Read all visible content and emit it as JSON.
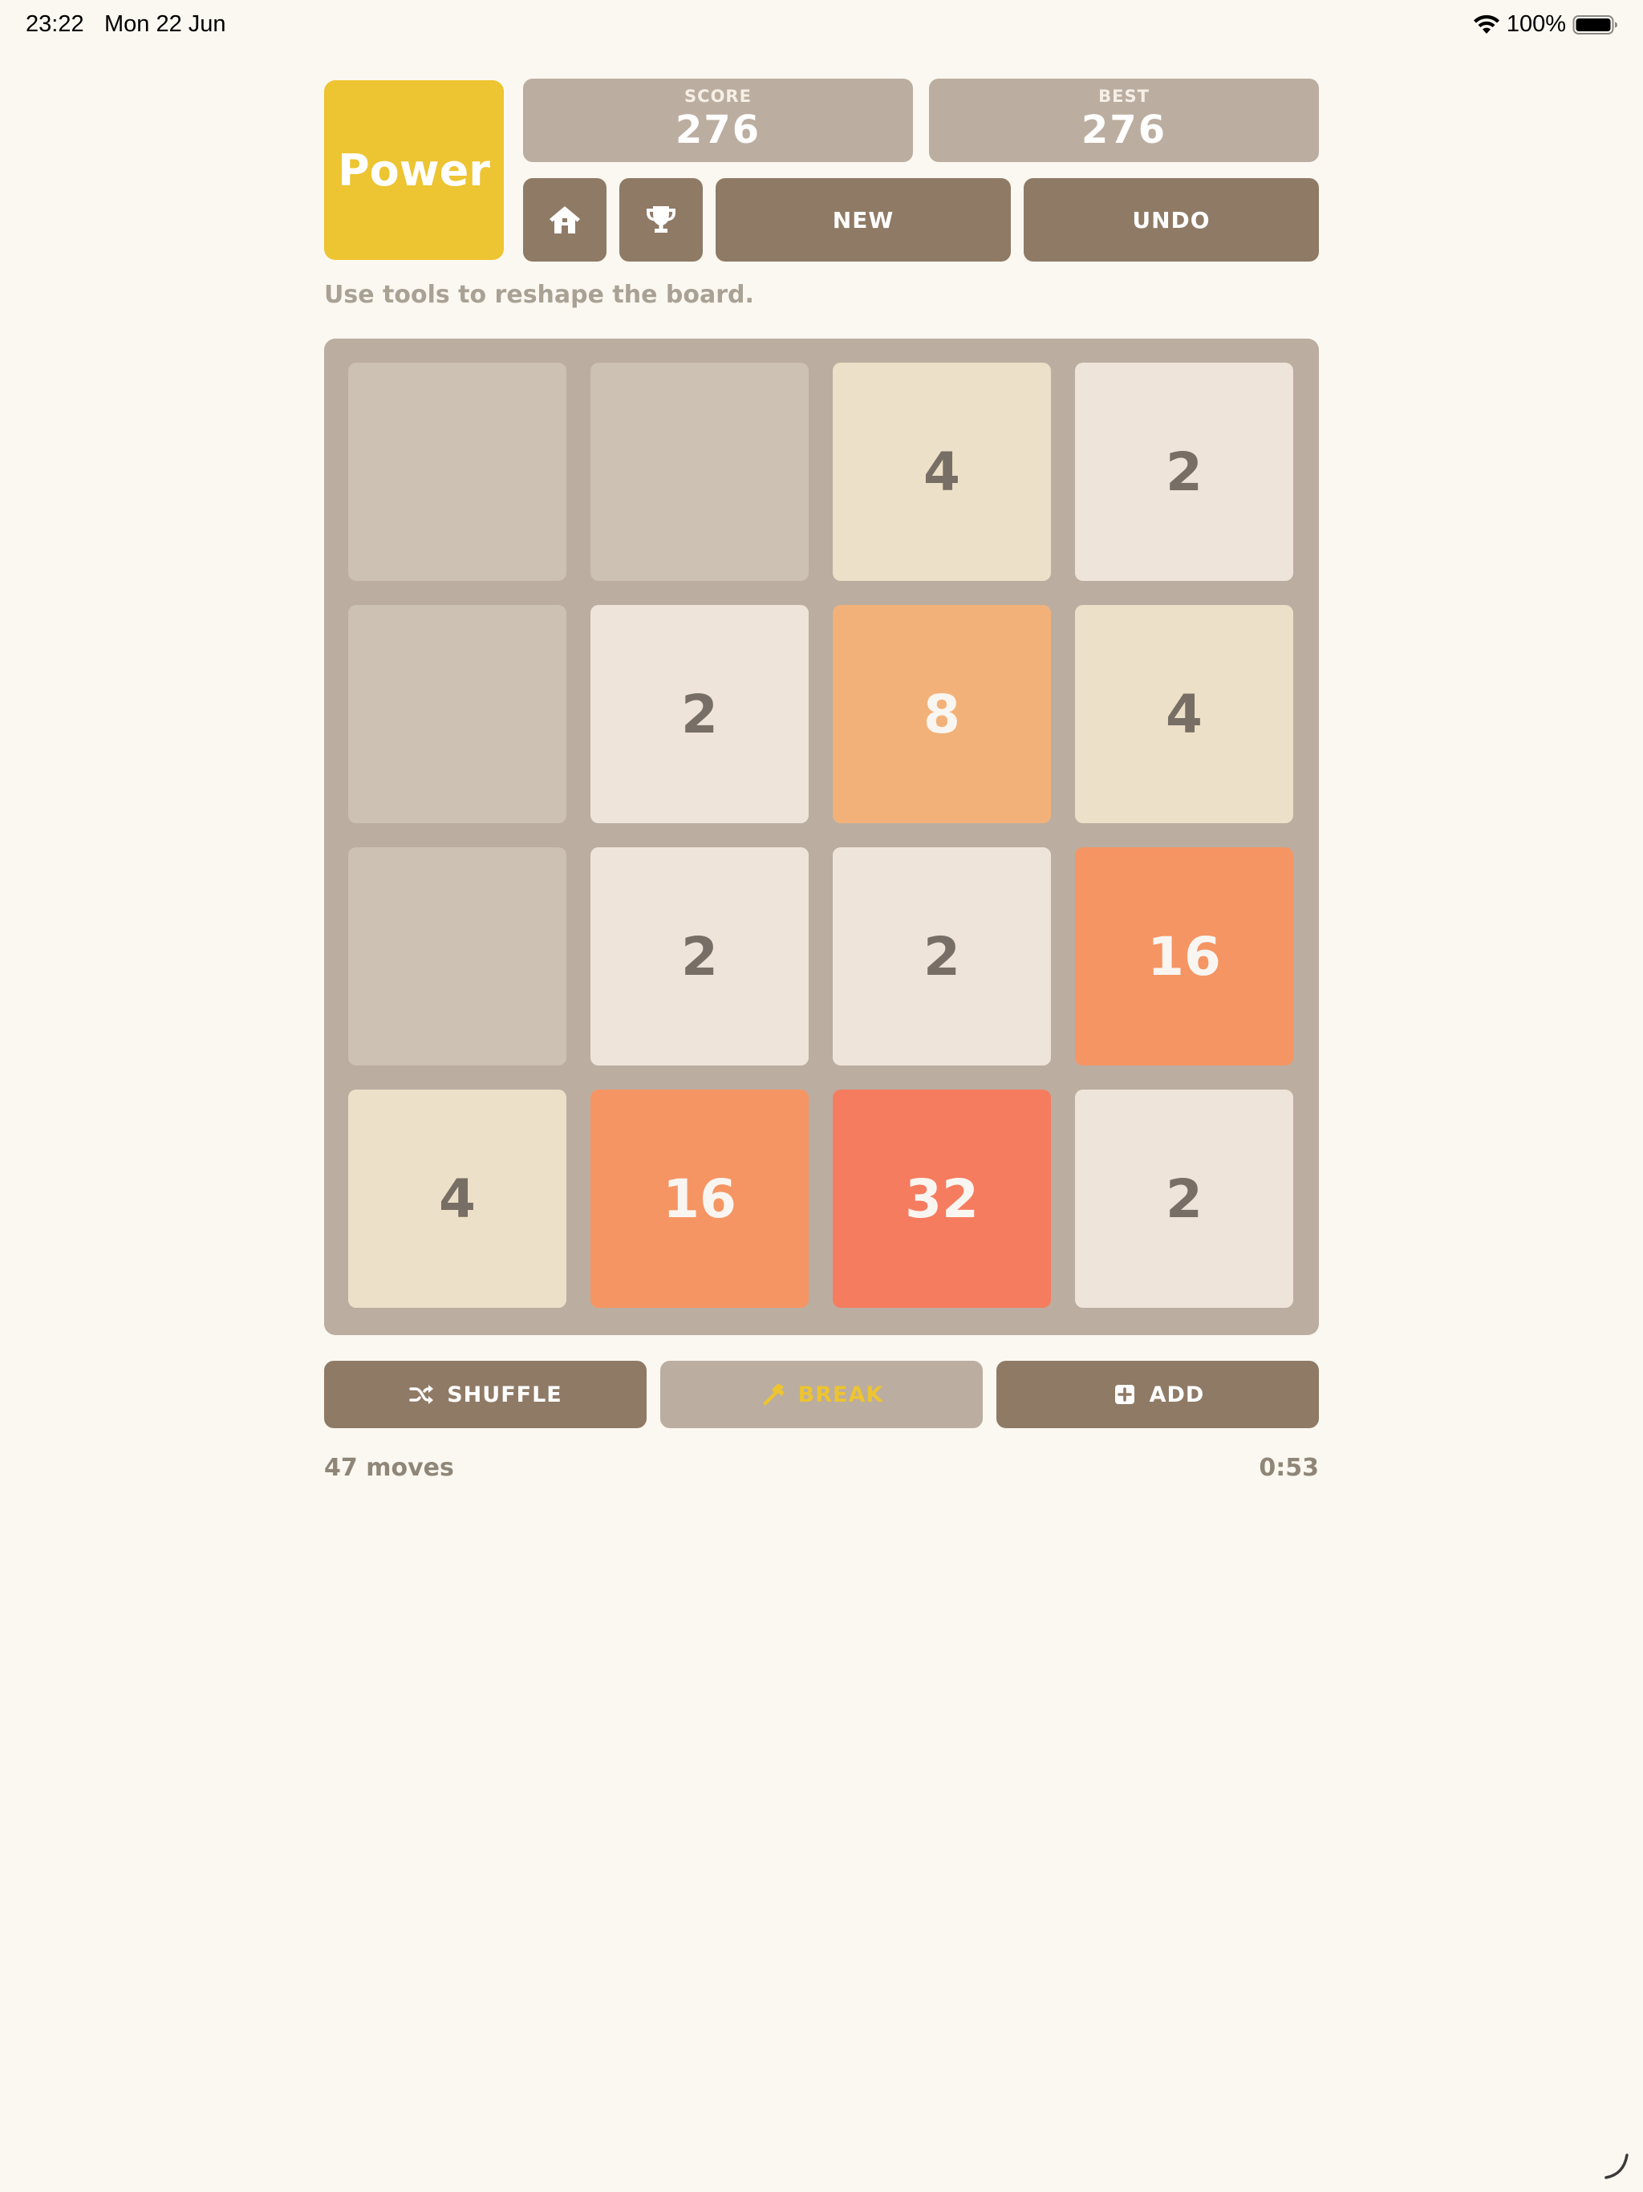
{
  "status_bar": {
    "time": "23:22",
    "date": "Mon 22 Jun",
    "battery": "100%"
  },
  "header": {
    "logo": "Power",
    "score_label": "SCORE",
    "score_value": "276",
    "best_label": "BEST",
    "best_value": "276",
    "home_icon": "home-icon",
    "trophy_icon": "trophy-icon",
    "new_label": "NEW",
    "undo_label": "UNDO"
  },
  "hint": "Use tools to reshape the board.",
  "board": {
    "size": 4,
    "grid": [
      [
        0,
        0,
        4,
        2
      ],
      [
        0,
        2,
        8,
        4
      ],
      [
        0,
        2,
        2,
        16
      ],
      [
        4,
        16,
        32,
        2
      ]
    ]
  },
  "tile_colors": {
    "empty": "#cdc1b4",
    "2": {
      "bg": "#eee4da",
      "fg": "#776e65"
    },
    "4": {
      "bg": "#ede0c8",
      "fg": "#776e65"
    },
    "8": {
      "bg": "#f2b179",
      "fg": "#f9f6f2"
    },
    "16": {
      "bg": "#f59563",
      "fg": "#f9f6f2"
    },
    "32": {
      "bg": "#f67c5f",
      "fg": "#f9f6f2"
    }
  },
  "tools": {
    "shuffle_label": "SHUFFLE",
    "shuffle_icon": "shuffle-icon",
    "break_label": "BREAK",
    "break_icon": "hammer-icon",
    "add_label": "ADD",
    "add_icon": "plus-square-icon"
  },
  "footer": {
    "moves": "47 moves",
    "timer": "0:53"
  },
  "colors": {
    "background": "#fbf8f1",
    "board": "#bbada0",
    "button": "#8f7a66",
    "logo": "#edc431",
    "accent_yellow": "#edc431"
  }
}
